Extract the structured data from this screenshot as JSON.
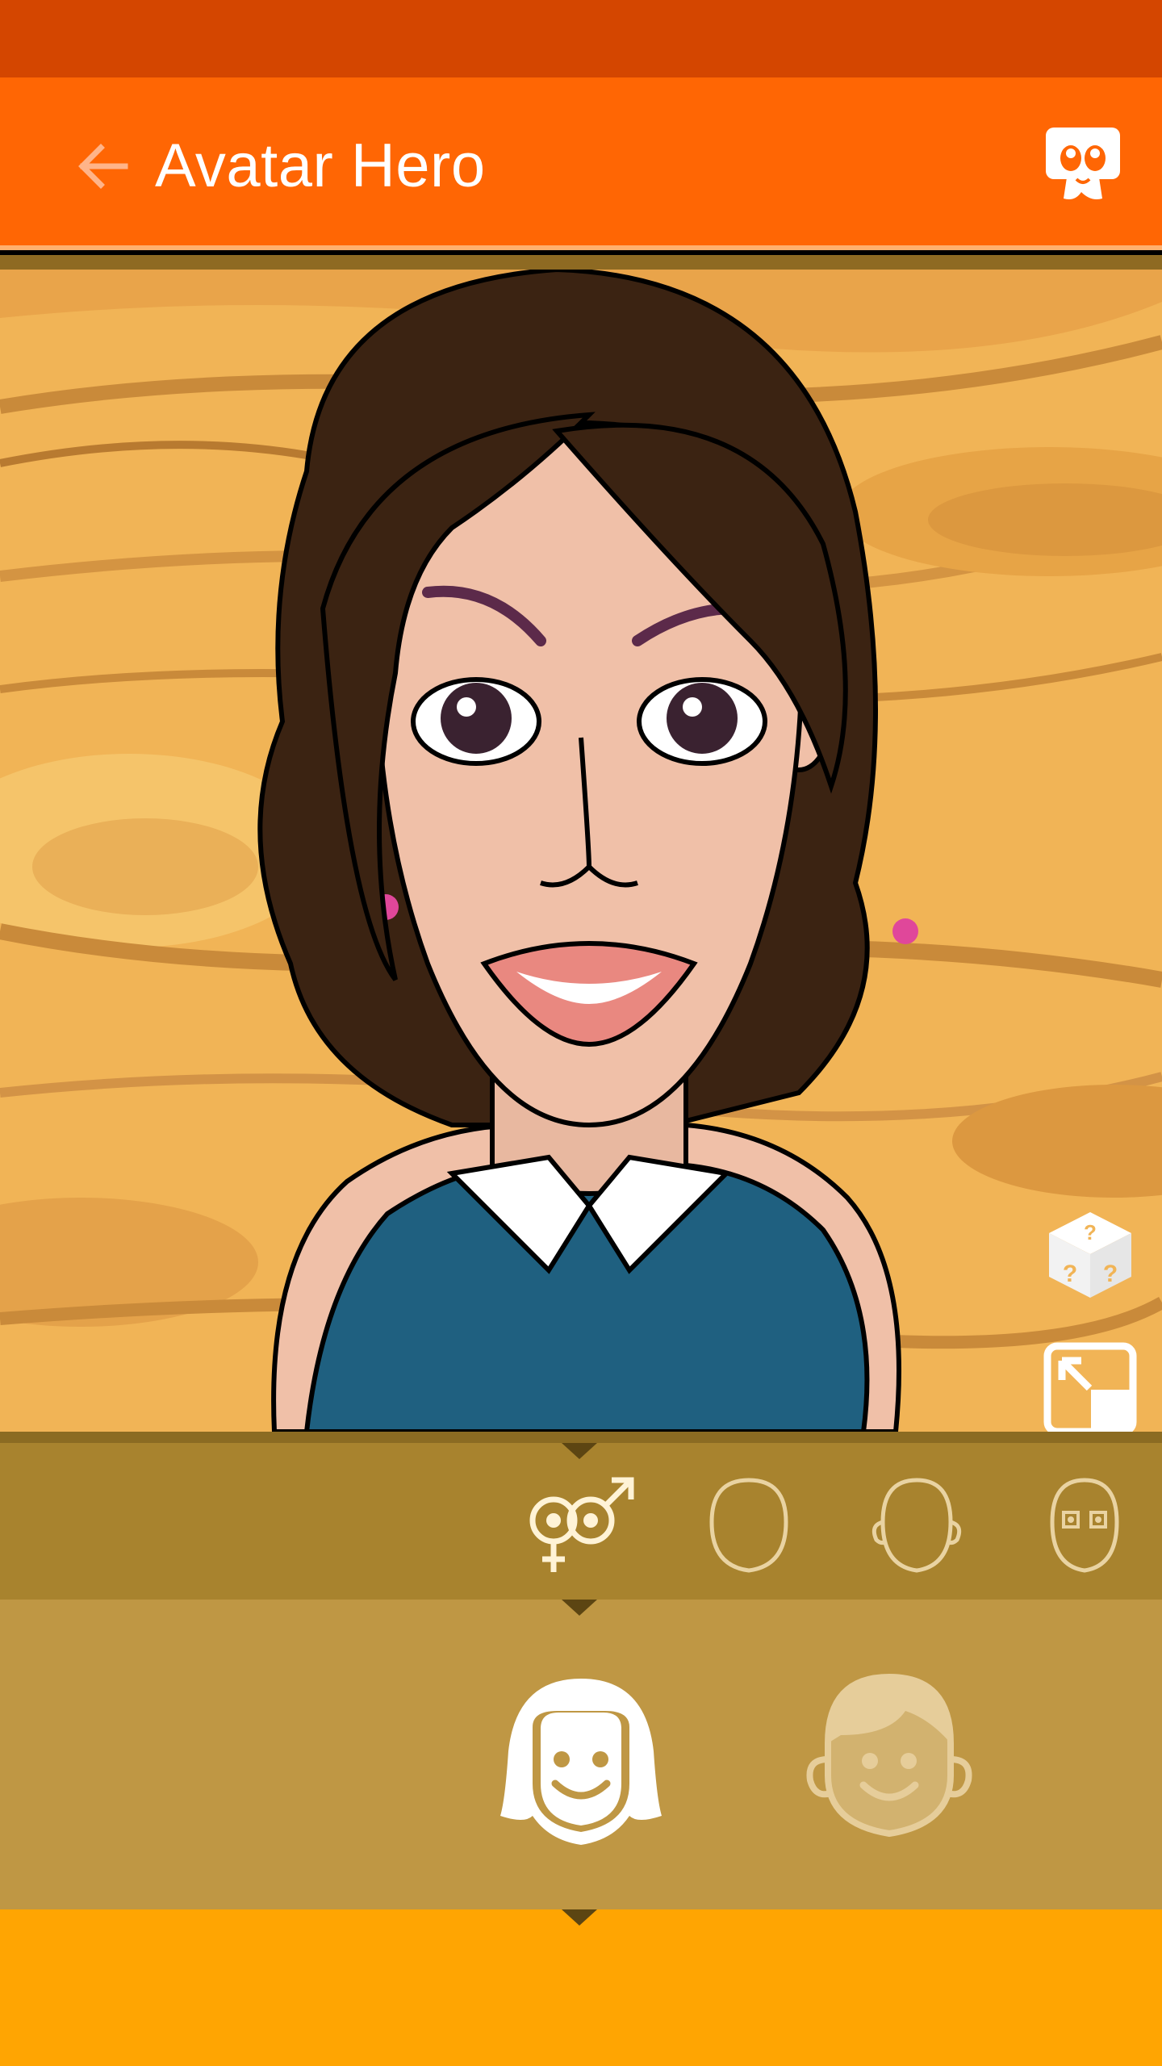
{
  "status_bar": {},
  "app_bar": {
    "title": "Avatar Hero",
    "icons": {
      "back": "arrow-left-icon",
      "logo": "avatar-hero-logo-icon"
    }
  },
  "stage": {
    "background": "wood-texture",
    "avatar": "female-avatar-cartoon",
    "buttons": {
      "randomize": "dice-icon",
      "expand": "expand-icon"
    }
  },
  "categories": {
    "items": [
      {
        "name": "gender",
        "icon": "gender-icon",
        "selected": true
      },
      {
        "name": "face-shape",
        "icon": "face-shape-icon",
        "selected": false
      },
      {
        "name": "head-ears",
        "icon": "head-ears-icon",
        "selected": false
      },
      {
        "name": "eyes",
        "icon": "eyes-face-icon",
        "selected": false
      }
    ]
  },
  "options": {
    "items": [
      {
        "name": "female",
        "icon": "female-face-icon",
        "selected": true
      },
      {
        "name": "male",
        "icon": "male-face-icon",
        "selected": false
      }
    ]
  },
  "colors": {
    "status_bar": "#d44600",
    "app_bar": "#ff6604",
    "category_bar": "#a8832e",
    "options_bar": "#bf9744",
    "bottom_bar": "#ffa502"
  }
}
